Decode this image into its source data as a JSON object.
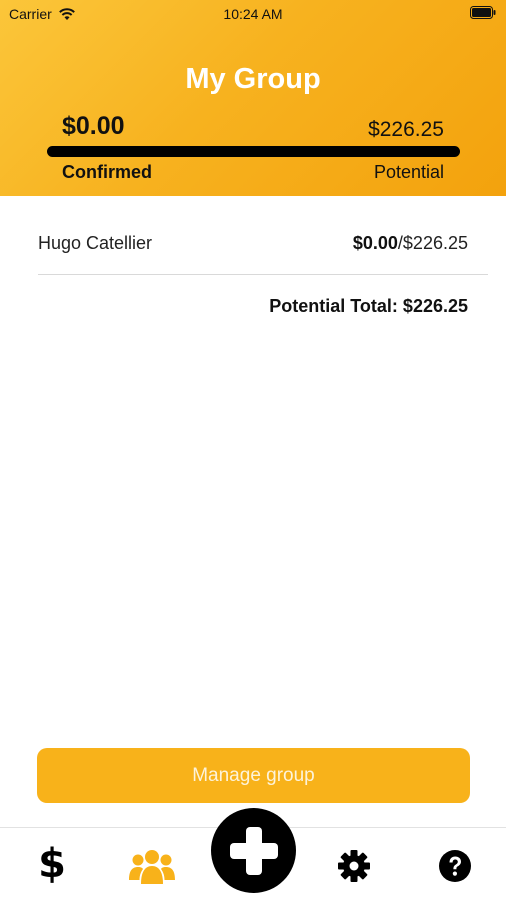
{
  "status_bar": {
    "carrier": "Carrier",
    "time": "10:24 AM"
  },
  "header": {
    "title": "My Group",
    "confirmed_amount": "$0.00",
    "potential_amount": "$226.25",
    "confirmed_label": "Confirmed",
    "potential_label": "Potential",
    "progress_fraction": 0.0,
    "background_color": "#f7b21f"
  },
  "members": [
    {
      "name": "Hugo Catellier",
      "confirmed": "$0.00",
      "potential": "/$226.25"
    }
  ],
  "potential_total": "Potential Total: $226.25",
  "manage_button_label": "Manage group",
  "accent_color": "#f8b21a",
  "tab_bar": {
    "items": [
      {
        "icon": "dollar-icon",
        "glyph": "$",
        "active": false
      },
      {
        "icon": "group-icon",
        "active": true
      },
      {
        "icon": "plus-icon",
        "active": false
      },
      {
        "icon": "gear-icon",
        "active": false
      },
      {
        "icon": "help-icon",
        "active": false
      }
    ]
  }
}
